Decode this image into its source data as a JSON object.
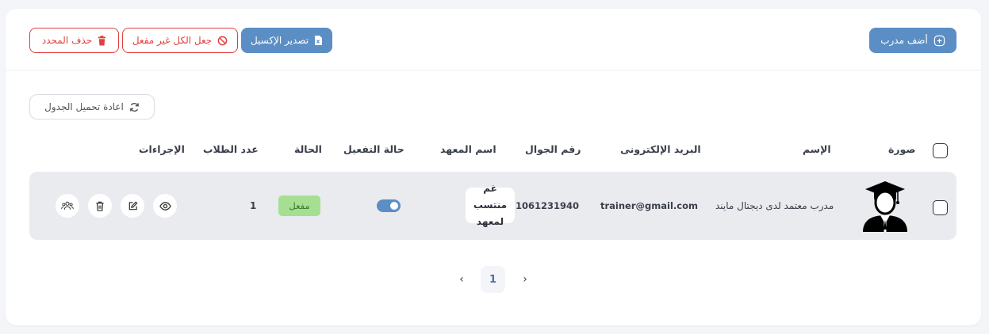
{
  "toolbar": {
    "add_trainer": "أضف مدرب",
    "export_excel": "تصدير الإكسيل",
    "deactivate_all": "جعل الكل غير مفعل",
    "delete_selected": "حذف المحدد"
  },
  "reload_label": "اعادة تحميل الجدول",
  "table": {
    "headers": {
      "photo": "صورة",
      "name": "الإسم",
      "email": "البريد الإلكترونى",
      "phone": "رقم الجوال",
      "institute": "اسم المعهد",
      "activation": "حالة التفعيل",
      "status": "الحالة",
      "students": "عدد الطلاب",
      "actions": "الإجراءات"
    },
    "rows": [
      {
        "name": "مدرب معتمد لدى ديجتال مايند",
        "email": "trainer@gmail.com",
        "phone": "1061231940",
        "institute_line1": "غم منتسب",
        "institute_line2": "لمعهد",
        "activation_on": true,
        "status": "مفعل",
        "students": "1"
      }
    ]
  },
  "pagination": {
    "current": "1",
    "prev": "‹",
    "next": "›"
  },
  "colors": {
    "primary": "#5b8ec4",
    "danger": "#e0403e",
    "success_bg": "#a6df92",
    "row_bg": "#e9ebef"
  }
}
